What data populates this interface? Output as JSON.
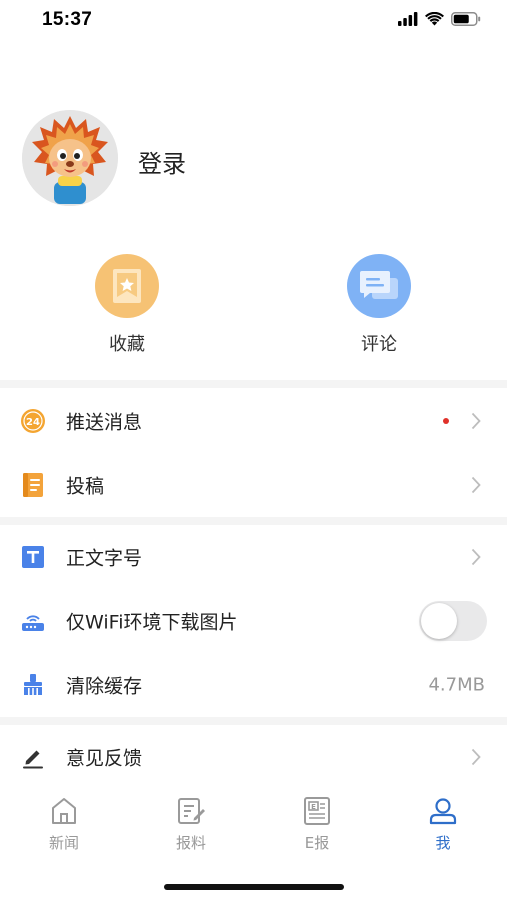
{
  "status_bar": {
    "time": "15:37"
  },
  "profile": {
    "login_label": "登录"
  },
  "quick_actions": [
    {
      "label": "收藏",
      "icon": "bookmark-icon",
      "color": "#f6c274"
    },
    {
      "label": "评论",
      "icon": "comment-icon",
      "color": "#7fb2f5"
    }
  ],
  "menu": {
    "push_messages": {
      "label": "推送消息",
      "icon": "push-24-icon",
      "has_unread_dot": true
    },
    "contribute": {
      "label": "投稿",
      "icon": "document-icon"
    },
    "font_size": {
      "label": "正文字号",
      "icon": "text-t-icon"
    },
    "wifi_only_images": {
      "label": "仅WiFi环境下载图片",
      "icon": "wifi-router-icon",
      "enabled": false
    },
    "clear_cache": {
      "label": "清除缓存",
      "icon": "broom-icon",
      "value": "4.7MB"
    },
    "feedback": {
      "label": "意见反馈",
      "icon": "pencil-icon"
    }
  },
  "tabbar": {
    "items": [
      {
        "label": "新闻",
        "icon": "home-icon",
        "active": false
      },
      {
        "label": "报料",
        "icon": "edit-note-icon",
        "active": false
      },
      {
        "label": "E报",
        "icon": "e-paper-icon",
        "active": false
      },
      {
        "label": "我",
        "icon": "user-icon",
        "active": true
      }
    ]
  },
  "colors": {
    "accent": "#2e6ec9",
    "unread_dot": "#e0312a"
  }
}
